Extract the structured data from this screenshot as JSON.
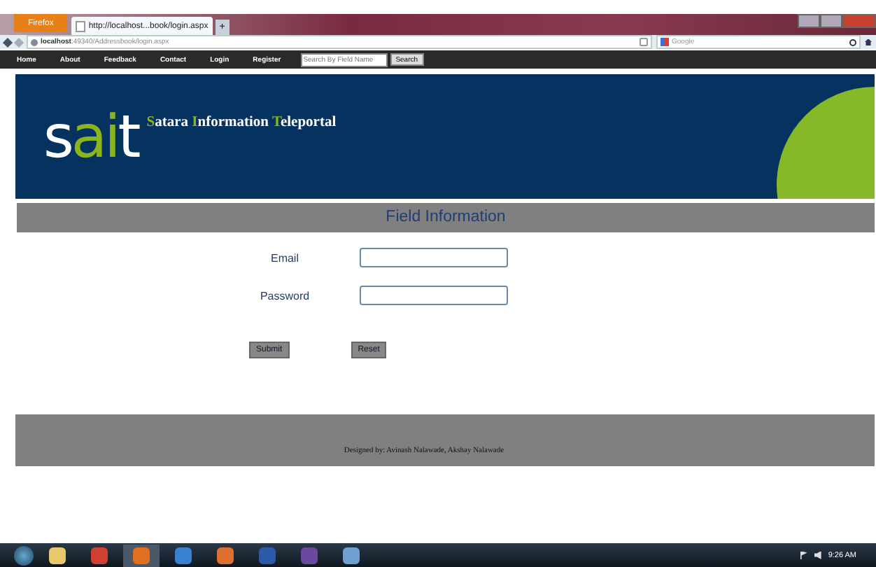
{
  "browser": {
    "menu_button": "Firefox",
    "tabs": [
      {
        "title": "http://localhost...book/login.aspx",
        "selected": true
      }
    ],
    "new_tab": "+",
    "address": {
      "host": "localhost",
      "path": ":49340/Addressbook/login.aspx"
    },
    "search_placeholder": "Google"
  },
  "nav": {
    "items": [
      "Home",
      "About",
      "Feedback",
      "Contact",
      "Login",
      "Register"
    ],
    "search_placeholder": "Search By Field Name",
    "search_button": "Search"
  },
  "header": {
    "logo": [
      {
        "text": "s",
        "accent": false
      },
      {
        "text": "ai",
        "accent": true
      },
      {
        "text": "t",
        "accent": false
      }
    ],
    "tagline": [
      {
        "initial": "S",
        "rest": "atara"
      },
      {
        "initial": "I",
        "rest": "nformation"
      },
      {
        "initial": "T",
        "rest": "eleportal"
      }
    ]
  },
  "section_title": "Field Information",
  "form": {
    "fields": [
      {
        "label": "Email"
      },
      {
        "label": "Password"
      }
    ],
    "buttons": [
      "Submit",
      "Reset"
    ]
  },
  "footer": "Designed by: Avinash Nalawade, Akshay Nalawade",
  "taskbar": {
    "apps": [
      {
        "kind": "folder",
        "active": false
      },
      {
        "kind": "chrome",
        "active": false
      },
      {
        "kind": "firefox",
        "active": true
      },
      {
        "kind": "ie",
        "active": false
      },
      {
        "kind": "media",
        "active": false
      },
      {
        "kind": "word",
        "active": false
      },
      {
        "kind": "vs",
        "active": false
      },
      {
        "kind": "paint",
        "active": false
      }
    ],
    "time": "9:26 AM"
  }
}
